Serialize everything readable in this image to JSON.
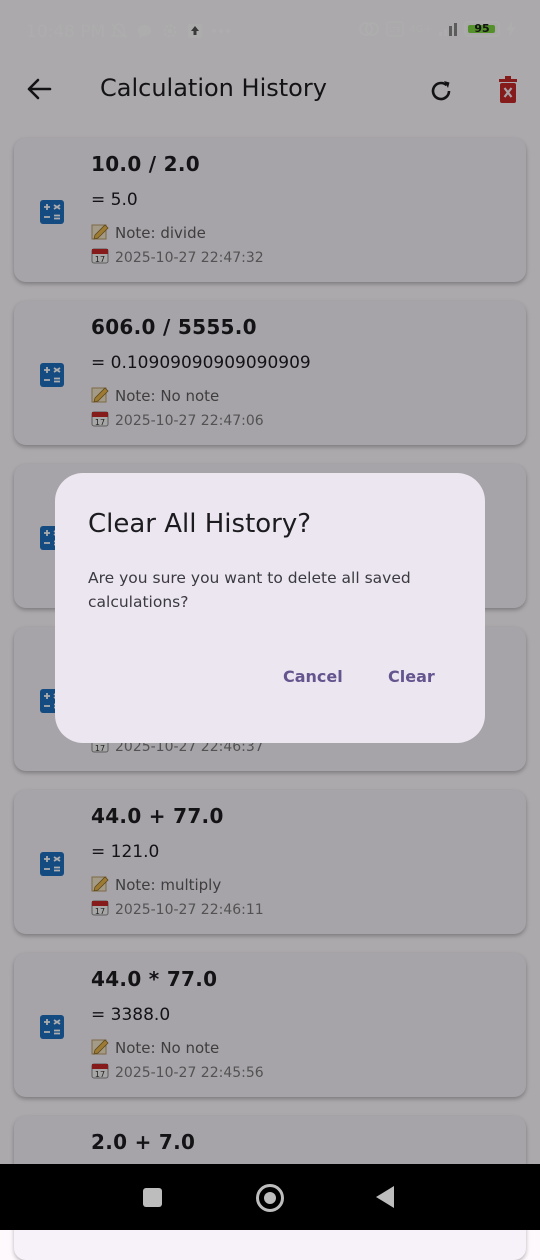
{
  "status": {
    "time": "10:48 PM",
    "battery": "95",
    "network": "4G+"
  },
  "appbar": {
    "title": "Calculation History"
  },
  "history": [
    {
      "expr": "10.0 / 2.0",
      "result": "= 5.0",
      "note": "Note: divide",
      "date": "2025-10-27 22:47:32"
    },
    {
      "expr": "606.0 / 5555.0",
      "result": "= 0.10909090909090909",
      "note": "Note: No note",
      "date": "2025-10-27 22:47:06"
    },
    {
      "expr": "",
      "result": "",
      "note": "",
      "date": ""
    },
    {
      "expr": "",
      "result": "",
      "note": "",
      "date": "2025-10-27 22:46:37"
    },
    {
      "expr": "44.0 + 77.0",
      "result": "= 121.0",
      "note": "Note: multiply",
      "date": "2025-10-27 22:46:11"
    },
    {
      "expr": "44.0 * 77.0",
      "result": "= 3388.0",
      "note": "Note: No note",
      "date": "2025-10-27 22:45:56"
    },
    {
      "expr": "2.0 + 7.0",
      "result": "",
      "note": "",
      "date": ""
    }
  ],
  "dialog": {
    "title": "Clear All History?",
    "message": "Are you sure you want to delete all saved calculations?",
    "cancel": "Cancel",
    "clear": "Clear"
  },
  "colors": {
    "accent": "#65558f",
    "delete": "#c62828",
    "calc_icon": "#1e6fbf"
  }
}
